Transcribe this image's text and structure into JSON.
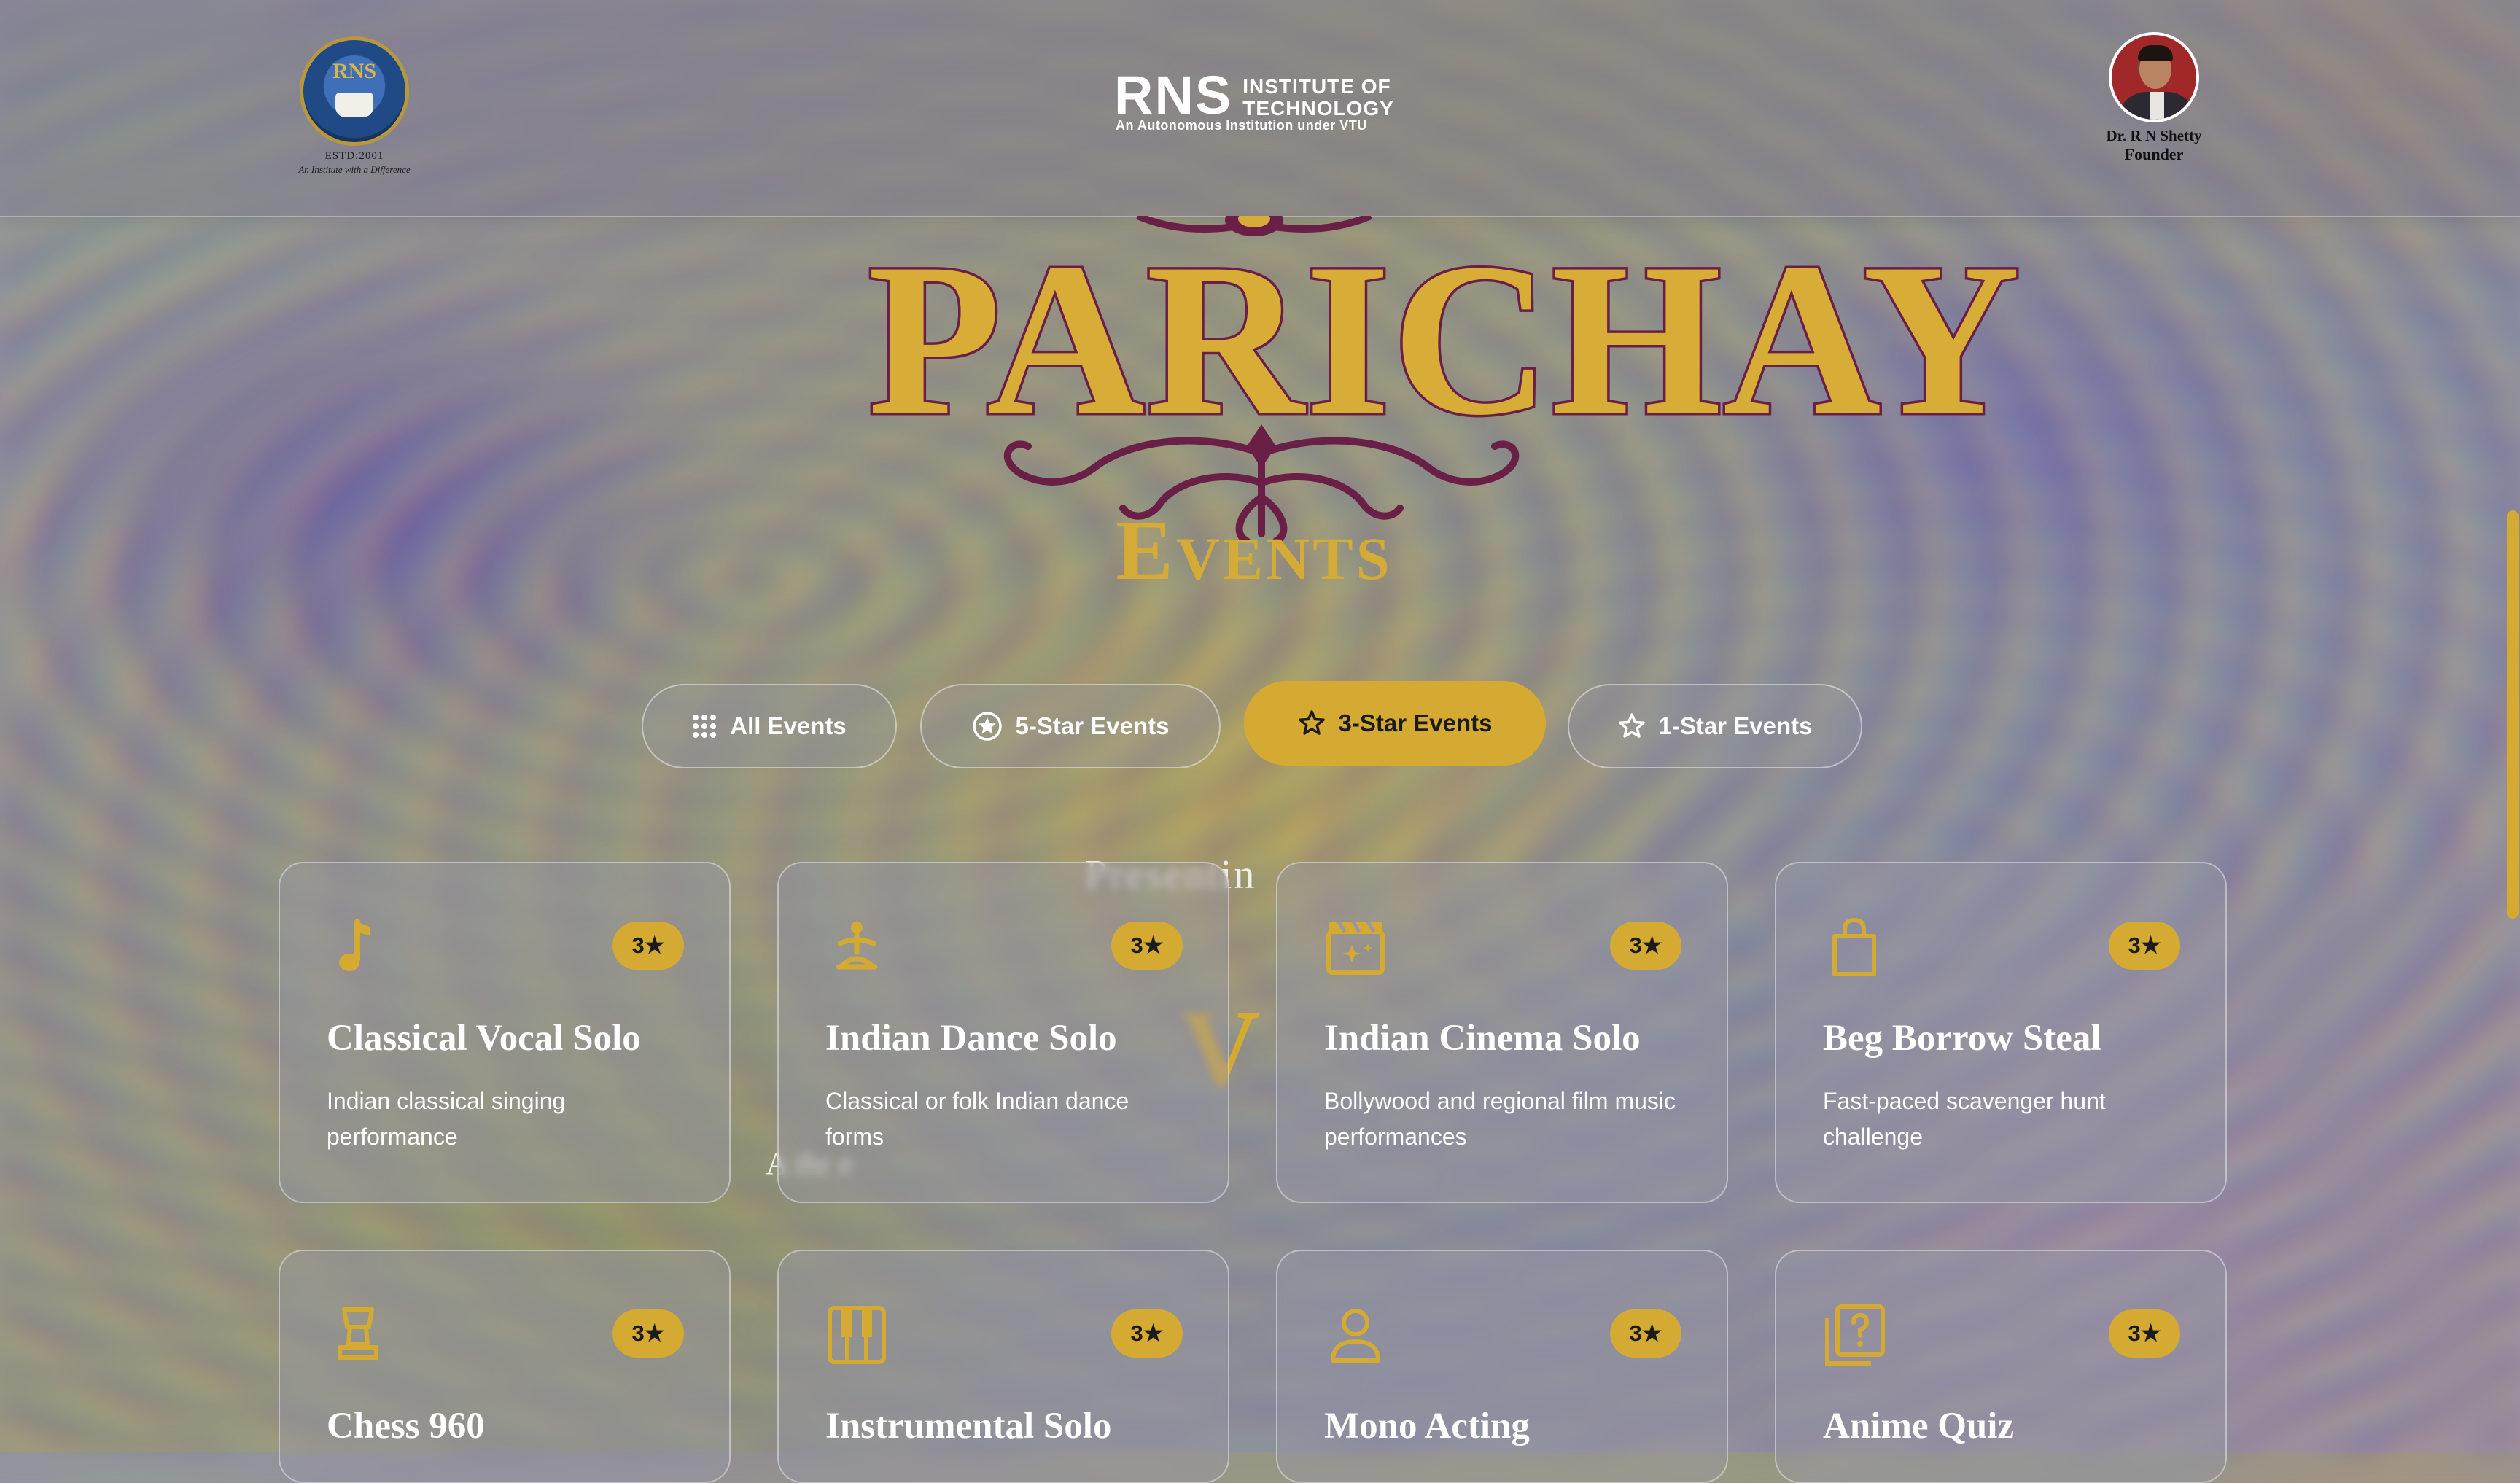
{
  "header": {
    "emblem": {
      "mark": "RNS",
      "estd": "ESTD:2001",
      "motto": "An Institute with a Difference"
    },
    "logo": {
      "big": "RNS",
      "line1": "INSTITUTE OF",
      "line2": "TECHNOLOGY",
      "sub": "An Autonomous Institution under VTU"
    },
    "founder": {
      "name": "Dr. R N Shetty",
      "role": "Founder"
    }
  },
  "hero": {
    "title": "PARICHAY",
    "subtitle": "Events"
  },
  "filters": [
    {
      "label": "All Events",
      "icon": "grid-icon"
    },
    {
      "label": "5-Star Events",
      "icon": "star-circle-icon"
    },
    {
      "label": "3-Star Events",
      "icon": "star-icon",
      "active": true
    },
    {
      "label": "1-Star Events",
      "icon": "star-icon"
    }
  ],
  "background_text": {
    "line1": "Presentin",
    "line2": "V",
    "line3": "A thr e"
  },
  "cards": [
    {
      "title": "Classical Vocal Solo",
      "desc": "Indian classical singing performance",
      "badge": "3★",
      "icon": "music-note-icon"
    },
    {
      "title": "Indian Dance Solo",
      "desc": "Classical or folk Indian dance forms",
      "badge": "3★",
      "icon": "dance-icon"
    },
    {
      "title": "Indian Cinema Solo",
      "desc": "Bollywood and regional film music performances",
      "badge": "3★",
      "icon": "cinema-icon"
    },
    {
      "title": "Beg Borrow Steal",
      "desc": "Fast-paced scavenger hunt challenge",
      "badge": "3★",
      "icon": "shopping-bag-icon"
    },
    {
      "title": "Chess 960",
      "desc": "",
      "badge": "3★",
      "icon": "chess-icon"
    },
    {
      "title": "Instrumental Solo",
      "desc": "",
      "badge": "3★",
      "icon": "piano-icon"
    },
    {
      "title": "Mono Acting",
      "desc": "",
      "badge": "3★",
      "icon": "person-icon"
    },
    {
      "title": "Anime Quiz",
      "desc": "",
      "badge": "3★",
      "icon": "quiz-icon"
    }
  ],
  "colors": {
    "accent": "#d4aa33",
    "maroon": "#6a1f47"
  }
}
